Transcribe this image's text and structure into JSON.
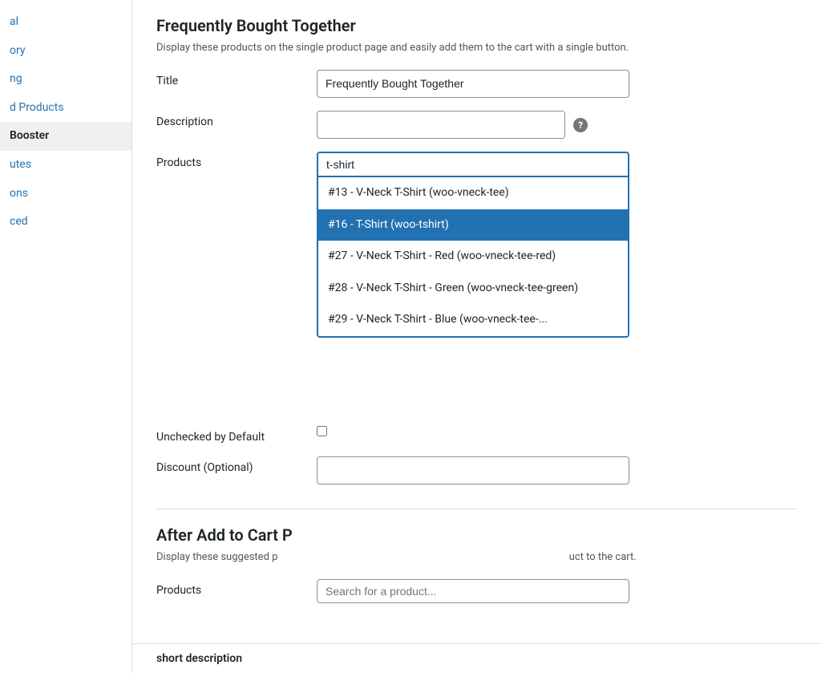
{
  "sidebar": {
    "items": [
      {
        "id": "general",
        "label": "al",
        "active": false
      },
      {
        "id": "inventory",
        "label": "ory",
        "active": false
      },
      {
        "id": "shipping",
        "label": "ng",
        "active": false
      },
      {
        "id": "linked-products",
        "label": "d Products",
        "active": false
      },
      {
        "id": "booster",
        "label": "Booster",
        "active": true
      },
      {
        "id": "attributes",
        "label": "utes",
        "active": false
      },
      {
        "id": "variations",
        "label": "ons",
        "active": false
      },
      {
        "id": "advanced",
        "label": "ced",
        "active": false
      }
    ]
  },
  "section1": {
    "title": "Frequently Bought Together",
    "description": "Display these products on the single product page and easily add them to the cart with a single button.",
    "fields": {
      "title_label": "Title",
      "title_value": "Frequently Bought Together",
      "description_label": "Description",
      "description_value": "",
      "products_label": "Products",
      "unchecked_label": "Unchecked by Default",
      "discount_label": "Discount (Optional)"
    },
    "dropdown": {
      "search_value": "t-shirt",
      "items": [
        {
          "id": 13,
          "label": "#13 - V-Neck T-Shirt (woo-vneck-tee)",
          "selected": false
        },
        {
          "id": 16,
          "label": "#16 - T-Shirt (woo-tshirt)",
          "selected": true
        },
        {
          "id": 27,
          "label": "#27 - V-Neck T-Shirt - Red (woo-vneck-tee-red)",
          "selected": false
        },
        {
          "id": 28,
          "label": "#28 - V-Neck T-Shirt - Green (woo-vneck-tee-green)",
          "selected": false
        },
        {
          "id": 29,
          "label": "#29 - V-Neck T-Shirt - Blue (woo-vneck-tee-...",
          "selected": false,
          "truncated": true
        }
      ]
    }
  },
  "section2": {
    "title": "After Add to Cart P",
    "description": "Display these suggested p",
    "description_suffix": "uct to the cart.",
    "fields": {
      "products_label": "Products",
      "products_placeholder": "Search for a product..."
    }
  },
  "bottom": {
    "label": "hort description"
  },
  "colors": {
    "accent": "#2271b1",
    "selected_bg": "#2271b1",
    "selected_text": "#ffffff"
  }
}
